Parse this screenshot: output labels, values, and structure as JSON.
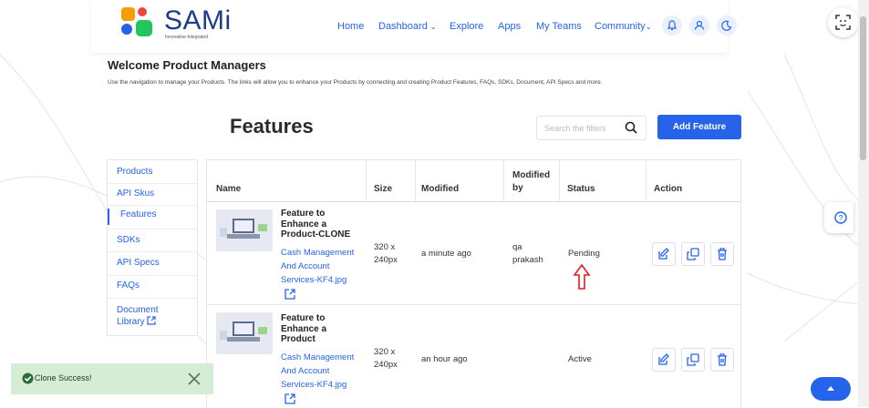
{
  "brand": {
    "name": "SAMi",
    "tagline": "Innovative-Integrated"
  },
  "nav": {
    "home": "Home",
    "dashboard": "Dashboard",
    "explore": "Explore",
    "apps": "Apps",
    "my_teams": "My Teams",
    "community": "Community"
  },
  "welcome": {
    "title": "Welcome Product Managers",
    "text": "Use the navigation to manage your Products. The links will allow you to enhance your Products by connecting and creating Product Features, FAQs, SDKs, Document, API Specs and more."
  },
  "page": {
    "title": "Features",
    "search_placeholder": "Search the filters",
    "add_button": "Add Feature"
  },
  "sidebar": {
    "items": [
      {
        "label": "Products"
      },
      {
        "label": "API Skus"
      },
      {
        "label": "Features"
      },
      {
        "label": "SDKs"
      },
      {
        "label": "API Specs"
      },
      {
        "label": "FAQs"
      },
      {
        "label": "Document Library"
      }
    ],
    "active": "Features"
  },
  "table": {
    "headers": {
      "name": "Name",
      "size": "Size",
      "modified": "Modified",
      "modified_by": "Modified by",
      "status": "Status",
      "action": "Action"
    },
    "rows": [
      {
        "title": "Feature to Enhance a Product-CLONE",
        "file": "Cash Management And Account Services-KF4.jpg",
        "size": "320 x 240px",
        "modified": "a minute ago",
        "modified_by": "qa prakash",
        "status": "Pending"
      },
      {
        "title": "Feature to Enhance a Product",
        "file": "Cash Management And Account Services-KF4.jpg",
        "size": "320 x 240px",
        "modified": "an hour ago",
        "modified_by": "",
        "status": "Active"
      }
    ]
  },
  "toast": {
    "message": "Clone Success!"
  },
  "colors": {
    "accent": "#2563eb",
    "toast_bg": "#d4edd4",
    "annotation": "#e11d1d"
  }
}
